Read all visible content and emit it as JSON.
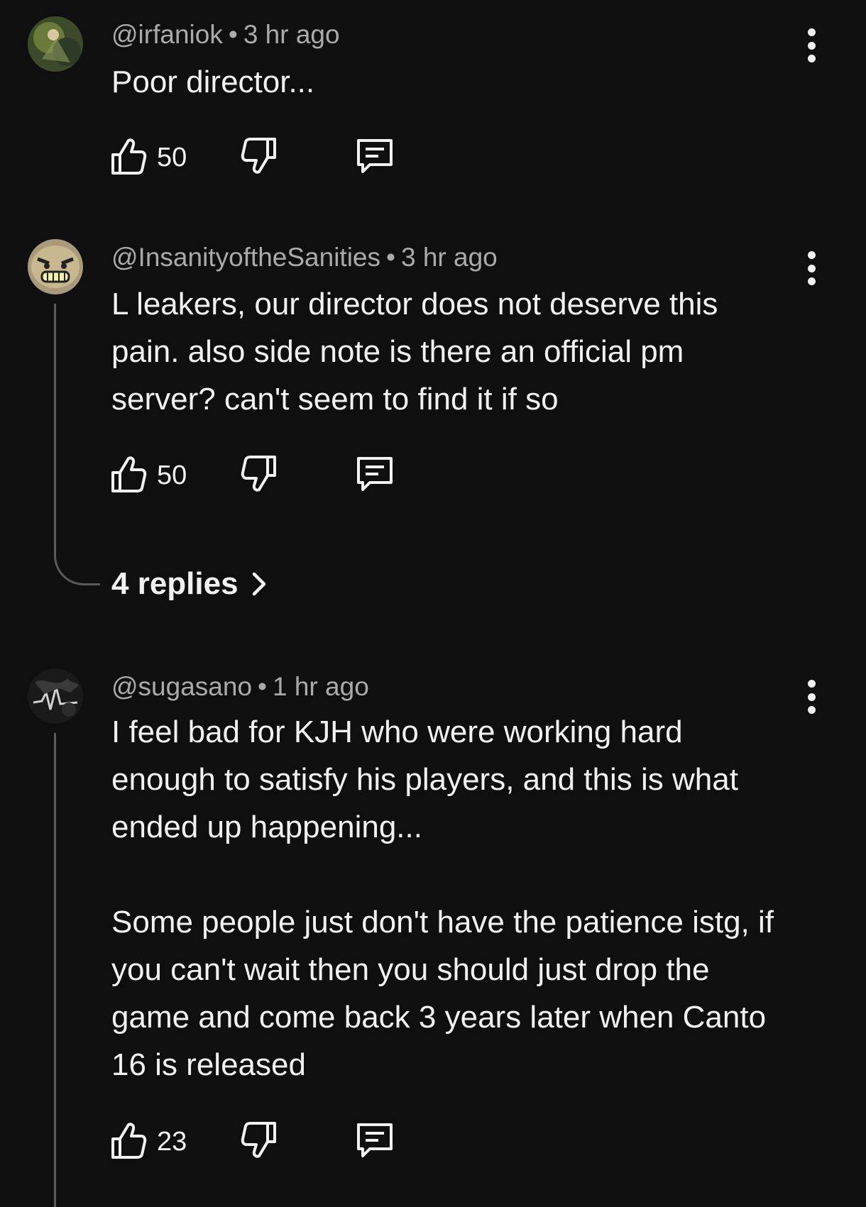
{
  "comments": [
    {
      "handle": "@irfaniok",
      "time": "3 hr ago",
      "text": "Poor director...",
      "likes": "50"
    },
    {
      "handle": "@InsanityoftheSanities",
      "time": "3 hr ago",
      "text": "L leakers, our director does not deserve this\npain. also side note is there an official pm\nserver? can't seem to find it if so",
      "likes": "50",
      "replies_label": "4 replies"
    },
    {
      "handle": "@sugasano",
      "time": "1 hr ago",
      "text": "I feel bad for KJH who were working hard\nenough to satisfy his players, and this is what\nended up happening...\n\nSome people just don't have the patience istg, if\nyou can't wait then you should just drop the\ngame and come back 3 years later when Canto\n16 is released",
      "likes": "23"
    }
  ],
  "separator": "•",
  "icons": {
    "like": "thumbs-up-icon",
    "dislike": "thumbs-down-icon",
    "reply": "comment-icon",
    "more": "more-vertical-icon",
    "chevron": "chevron-right-icon"
  },
  "colors": {
    "background": "#0f0f0f",
    "text": "#f1f1f1",
    "meta": "#aaaaaa",
    "thread_line": "#5a5a5a"
  }
}
